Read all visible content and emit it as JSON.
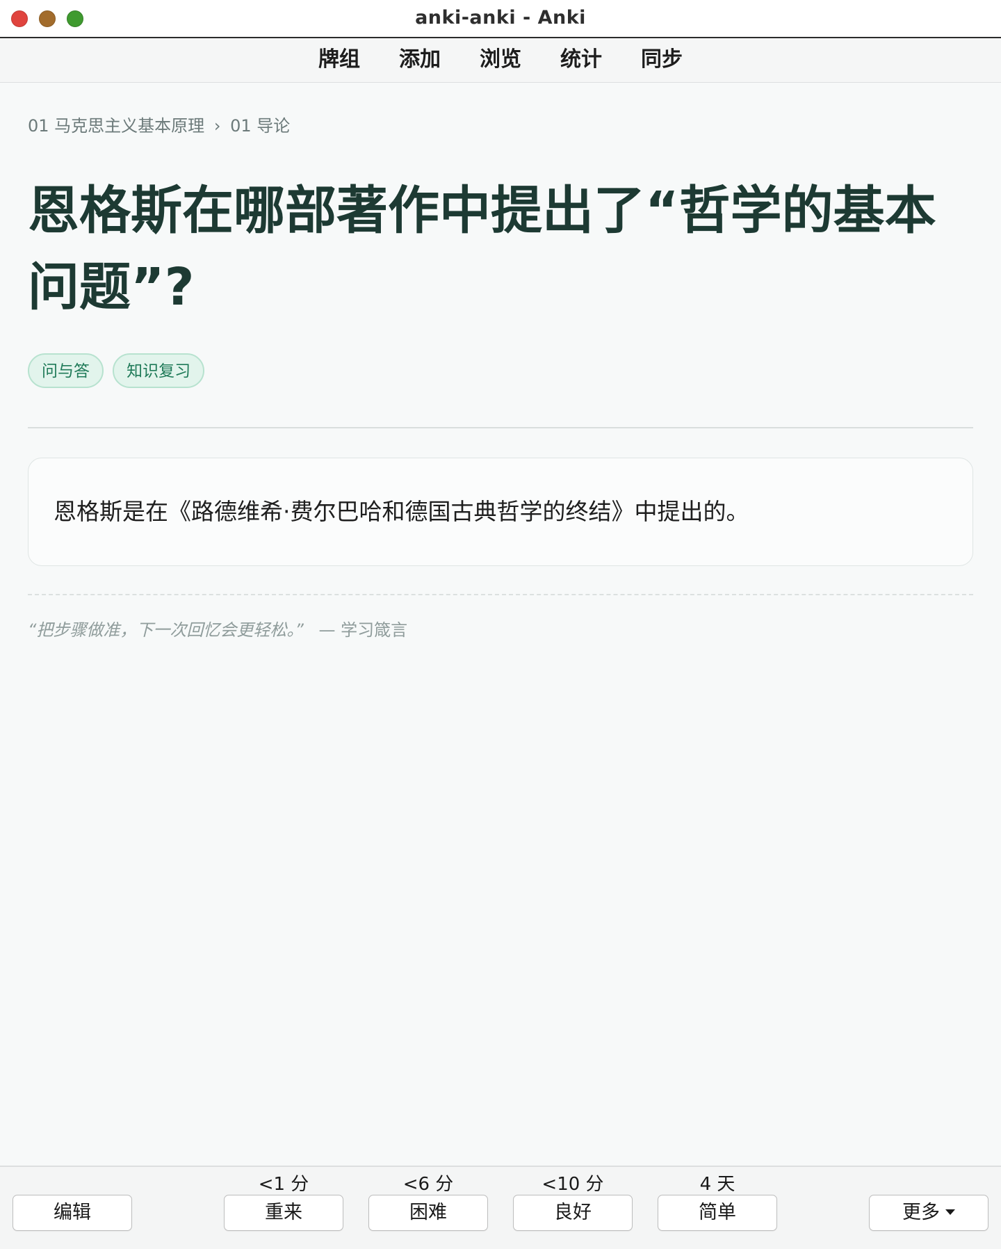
{
  "window": {
    "title": "anki-anki - Anki",
    "controls": [
      "close",
      "minimize",
      "maximize"
    ]
  },
  "menu": {
    "items": [
      "牌组",
      "添加",
      "浏览",
      "统计",
      "同步"
    ]
  },
  "breadcrumb": {
    "deck": "01 马克思主义基本原理",
    "separator": "›",
    "subdeck": "01 导论"
  },
  "card": {
    "question": "恩格斯在哪部著作中提出了“哲学的基本问题”?",
    "tags": [
      "问与答",
      "知识复习"
    ],
    "answer": "恩格斯是在《路德维希·费尔巴哈和德国古典哲学的终结》中提出的。",
    "quote": {
      "text": "“把步骤做准，下一次回忆会更轻松。”",
      "source": "— 学习箴言"
    }
  },
  "bottom_bar": {
    "edit_label": "编辑",
    "answers": [
      {
        "interval": "<1 分",
        "label": "重来"
      },
      {
        "interval": "<6 分",
        "label": "困难"
      },
      {
        "interval": "<10 分",
        "label": "良好"
      },
      {
        "interval": "4 天",
        "label": "简单"
      }
    ],
    "more_label": "更多"
  }
}
